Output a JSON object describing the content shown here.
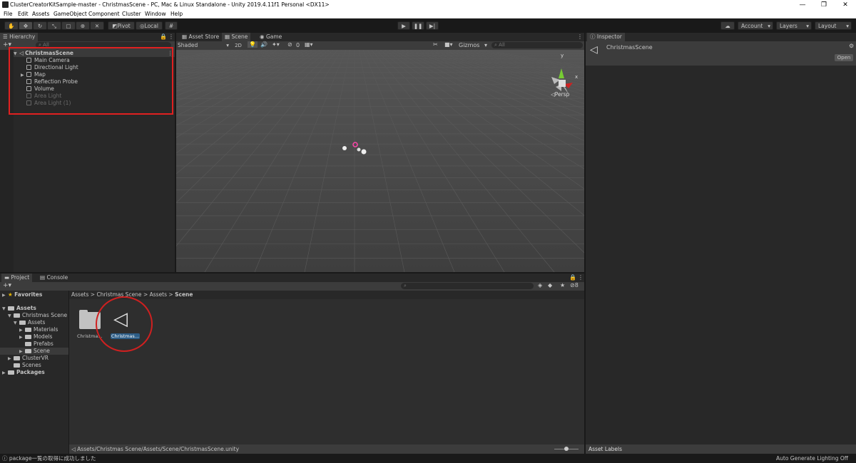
{
  "window": {
    "title": "ClusterCreatorKitSample-master - ChristmasScene - PC, Mac & Linux Standalone - Unity 2019.4.11f1 Personal <DX11>",
    "minimize": "—",
    "maximize": "❐",
    "close": "✕"
  },
  "menu": [
    "File",
    "Edit",
    "Assets",
    "GameObject",
    "Component",
    "Cluster",
    "Window",
    "Help"
  ],
  "toolbar": {
    "pivot": "Pivot",
    "local": "Local",
    "account": "Account",
    "layers": "Layers",
    "layout": "Layout"
  },
  "hierarchy": {
    "tab": "Hierarchy",
    "search_placeholder": "All",
    "scene": "ChristmasScene",
    "items": [
      {
        "label": "Main Camera"
      },
      {
        "label": "Directional Light"
      },
      {
        "label": "Map"
      },
      {
        "label": "Reflection Probe"
      },
      {
        "label": "Volume"
      },
      {
        "label": "Area Light"
      },
      {
        "label": "Area Light (1)"
      }
    ]
  },
  "scene_view": {
    "tabs": [
      "Asset Store",
      "Scene",
      "Game"
    ],
    "shading": "Shaded",
    "mode_2d": "2D",
    "hidden_count": "0",
    "gizmos": "Gizmos",
    "search_placeholder": "All",
    "persp": "Persp",
    "axis_y": "y",
    "axis_x": "x"
  },
  "inspector": {
    "tab": "Inspector",
    "object": "ChristmasScene",
    "open": "Open",
    "asset_labels": "Asset Labels"
  },
  "project": {
    "tabs": [
      "Project",
      "Console"
    ],
    "favorites": "Favorites",
    "tree": [
      {
        "label": "Assets"
      },
      {
        "label": "Christmas Scene"
      },
      {
        "label": "Assets"
      },
      {
        "label": "Materials"
      },
      {
        "label": "Models"
      },
      {
        "label": "Prefabs"
      },
      {
        "label": "Scene"
      },
      {
        "label": "ClusterVR"
      },
      {
        "label": "Scenes"
      },
      {
        "label": "Packages"
      }
    ],
    "breadcrumb": [
      "Assets",
      "Christmas Scene",
      "Assets",
      "Scene"
    ],
    "hidden_count": "8",
    "files": [
      {
        "label": "Christma..."
      },
      {
        "label": "Christmas..."
      }
    ],
    "path": "Assets/Christmas Scene/Assets/Scene/ChristmasScene.unity"
  },
  "status": {
    "message": "package一覧の取得に成功しました",
    "lighting": "Auto Generate Lighting Off"
  }
}
